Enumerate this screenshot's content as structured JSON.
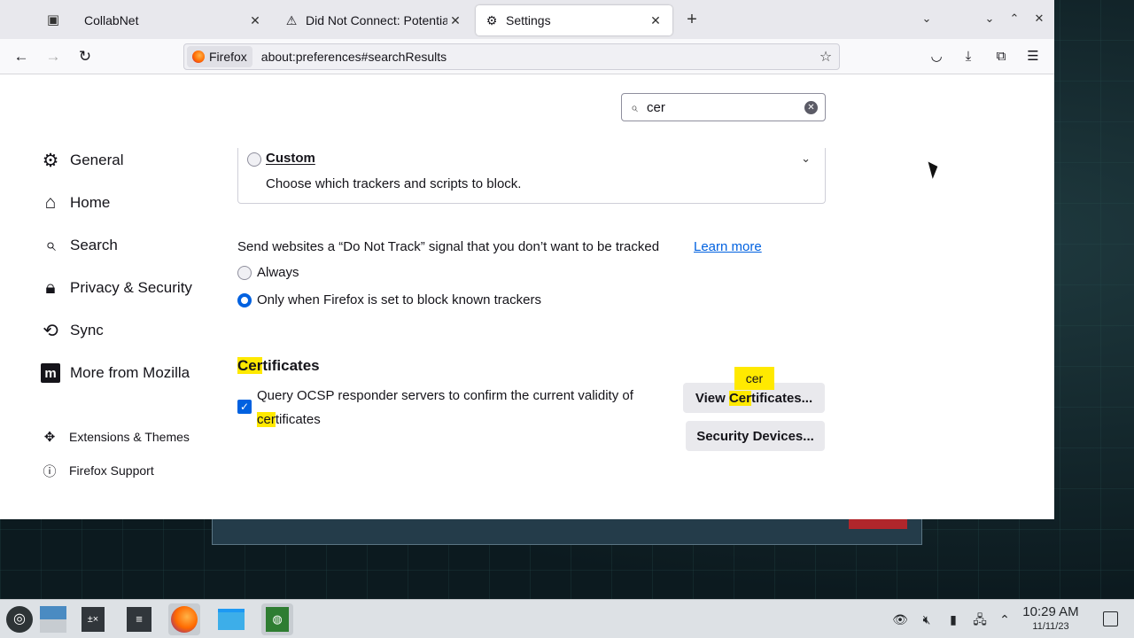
{
  "tabs": [
    {
      "title": "CollabNet",
      "close": "✕"
    },
    {
      "title": "Did Not Connect: Potential",
      "close": "✕"
    },
    {
      "title": "Settings",
      "close": "✕"
    }
  ],
  "urlbar": {
    "identity_label": "Firefox",
    "url": "about:preferences#searchResults"
  },
  "search": {
    "value": "cer",
    "clear_glyph": "✕"
  },
  "sidebar": {
    "categories": [
      {
        "label": "General",
        "icon": "gear-icon"
      },
      {
        "label": "Home",
        "icon": "home-icon"
      },
      {
        "label": "Search",
        "icon": "search-icon"
      },
      {
        "label": "Privacy & Security",
        "icon": "lock-icon"
      },
      {
        "label": "Sync",
        "icon": "sync-icon"
      },
      {
        "label": "More from Mozilla",
        "icon": "mozilla-icon"
      }
    ],
    "links": [
      {
        "label": "Extensions & Themes",
        "icon": "puzzle-icon"
      },
      {
        "label": "Firefox Support",
        "icon": "help-icon"
      }
    ]
  },
  "custom": {
    "title": "Custom",
    "description": "Choose which trackers and scripts to block."
  },
  "dnt": {
    "text": "Send websites a “Do Not Track” signal that you don’t want to be tracked",
    "learn_more": "Learn more",
    "options": [
      "Always",
      "Only when Firefox is set to block known trackers"
    ],
    "selected": "Only when Firefox is set to block known trackers"
  },
  "certificates": {
    "heading_highlight": "Cer",
    "heading_rest": "tificates",
    "ocsp_line1": "Query OCSP responder servers to confirm the current validity of",
    "ocsp_line2_highlight": "cer",
    "ocsp_line2_rest": "tificates",
    "ocsp_checked": true,
    "tooltip": "cer",
    "view_btn_pre": "View ",
    "view_btn_hl": "Cer",
    "view_btn_post": "tificates...",
    "devices_btn": "Security Devices..."
  },
  "clock": {
    "time": "10:29 AM",
    "date": "11/11/23"
  },
  "colors": {
    "accent": "#0061e0",
    "highlight": "#ffe900"
  }
}
